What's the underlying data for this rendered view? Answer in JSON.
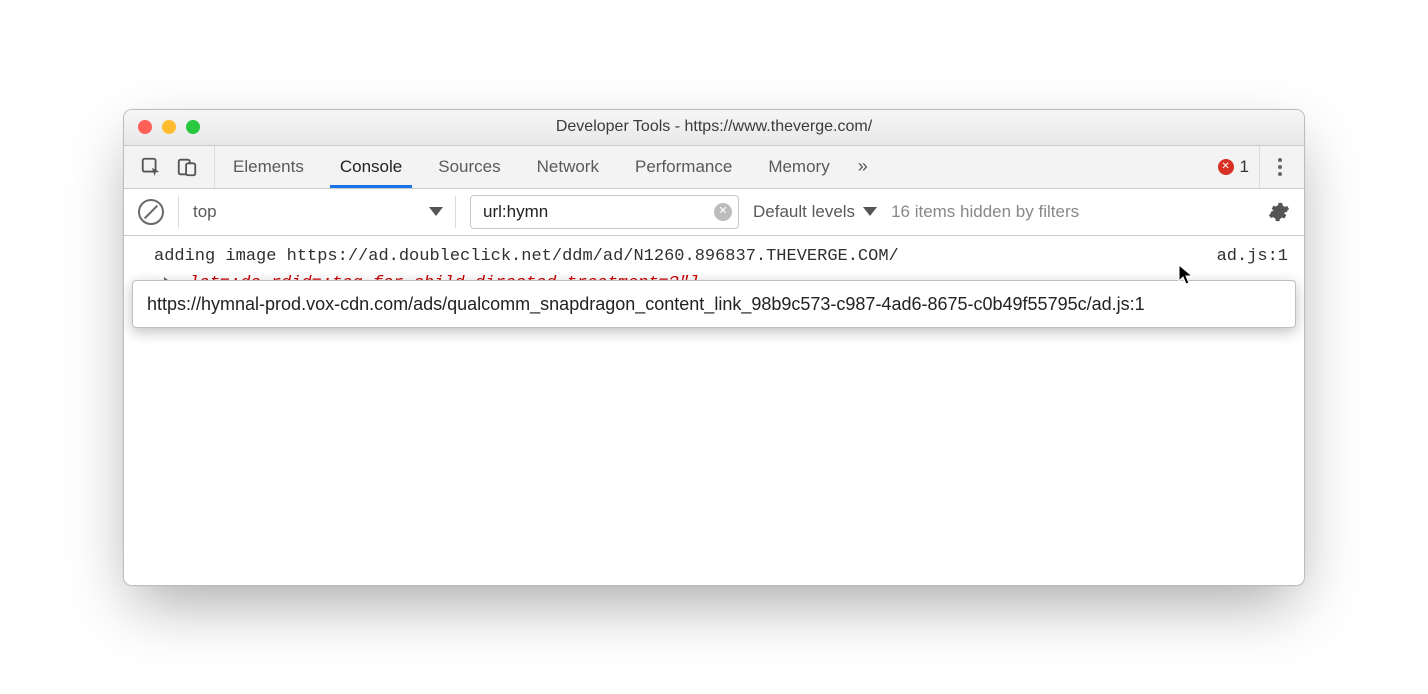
{
  "title": "Developer Tools - https://www.theverge.com/",
  "tabs": {
    "elements": "Elements",
    "console": "Console",
    "sources": "Sources",
    "network": "Network",
    "performance": "Performance",
    "memory": "Memory",
    "overflow_glyph": "»"
  },
  "error_badge": {
    "count": "1"
  },
  "filter": {
    "context": "top",
    "input_value": "url:hymn",
    "levels": "Default levels",
    "hidden": "16 items hidden by filters"
  },
  "log": {
    "msg_prefix": "adding image  ",
    "msg_url": "https://ad.doubleclick.net/ddm/ad/N1260.896837.THEVERGE.COM/",
    "source": "ad.js:1",
    "expand_text": "_lat=;dc_rdid=;tag_for_child_directed_treatment=?\"]"
  },
  "tooltip": "https://hymnal-prod.vox-cdn.com/ads/qualcomm_snapdragon_content_link_98b9c573-c987-4ad6-8675-c0b49f55795c/ad.js:1",
  "prompt_glyph": "›"
}
